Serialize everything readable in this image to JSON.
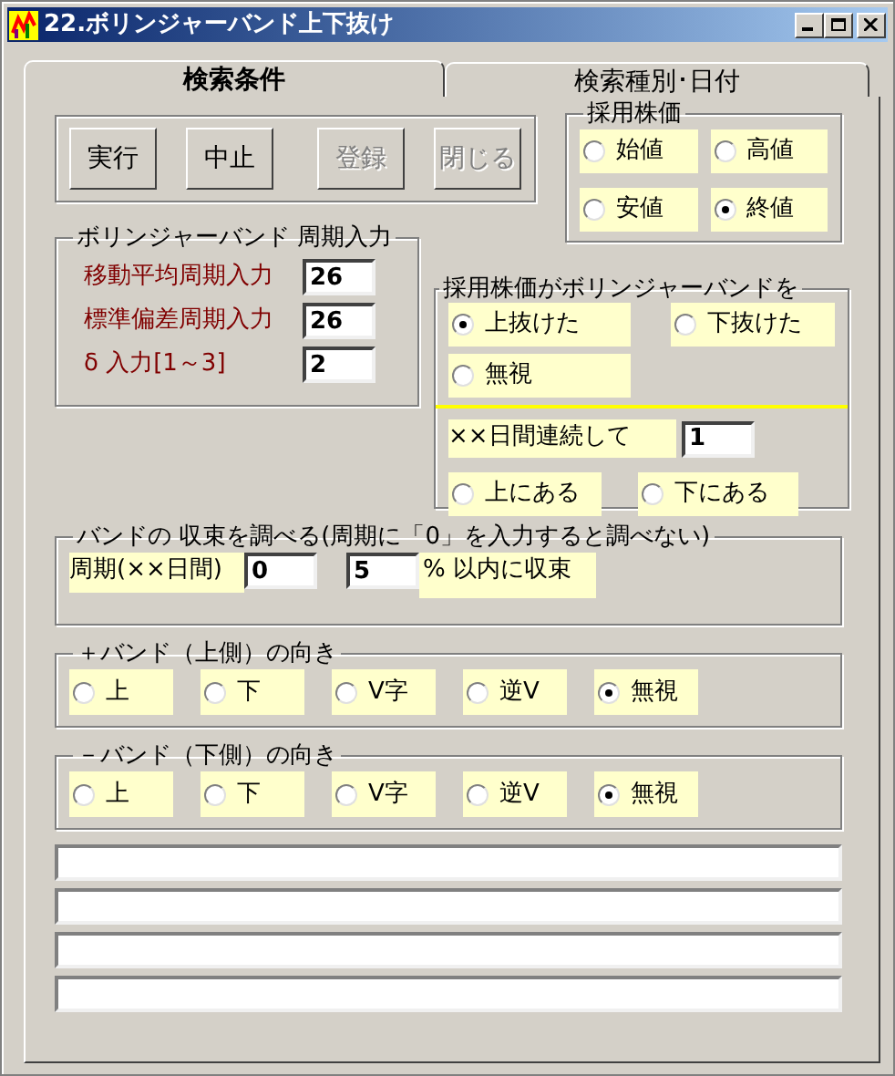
{
  "window": {
    "title": "22.ボリンジャーバンド上下抜け"
  },
  "tabs": [
    {
      "label": "検索条件",
      "selected": true
    },
    {
      "label": "検索種別･日付",
      "selected": false
    }
  ],
  "buttons": [
    {
      "label": "実行",
      "disabled": false
    },
    {
      "label": "中止",
      "disabled": false
    },
    {
      "label": "登録",
      "disabled": true
    },
    {
      "label": "閉じる",
      "disabled": true
    }
  ],
  "price_type": {
    "title": "採用株価",
    "options": [
      {
        "label": "始値",
        "selected": false
      },
      {
        "label": "高値",
        "selected": false
      },
      {
        "label": "安値",
        "selected": false
      },
      {
        "label": "終値",
        "selected": true
      }
    ]
  },
  "bollinger_period": {
    "title": "ボリンジャーバンド 周期入力",
    "fields": [
      {
        "label": "移動平均周期入力",
        "value": "26"
      },
      {
        "label": "標準偏差周期入力",
        "value": "26"
      },
      {
        "label": "δ 入力[1～3]",
        "value": "2"
      }
    ]
  },
  "crossing": {
    "title": "採用株価がボリンジャーバンドを",
    "options": [
      {
        "label": "上抜けた",
        "selected": true
      },
      {
        "label": "下抜けた",
        "selected": false
      },
      {
        "label": "無視",
        "selected": false
      }
    ],
    "days_label": "××日間連続して",
    "days_value": "1",
    "position_options": [
      {
        "label": "上にある",
        "selected": false
      },
      {
        "label": "下にある",
        "selected": false
      }
    ]
  },
  "convergence": {
    "title": "バンドの 収束を調べる(周期に「0」を入力すると調べない)",
    "period_label": "周期(××日間)",
    "period_value": "0",
    "percent_value": "5",
    "percent_label": "% 以内に収束"
  },
  "upper_band": {
    "title": "＋バンド（上側）の向き",
    "options": [
      {
        "label": "上",
        "selected": false
      },
      {
        "label": "下",
        "selected": false
      },
      {
        "label": "V字",
        "selected": false
      },
      {
        "label": "逆V",
        "selected": false
      },
      {
        "label": "無視",
        "selected": true
      }
    ]
  },
  "lower_band": {
    "title": "－バンド（下側）の向き",
    "options": [
      {
        "label": "上",
        "selected": false
      },
      {
        "label": "下",
        "selected": false
      },
      {
        "label": "V字",
        "selected": false
      },
      {
        "label": "逆V",
        "selected": false
      },
      {
        "label": "無視",
        "selected": true
      }
    ]
  }
}
